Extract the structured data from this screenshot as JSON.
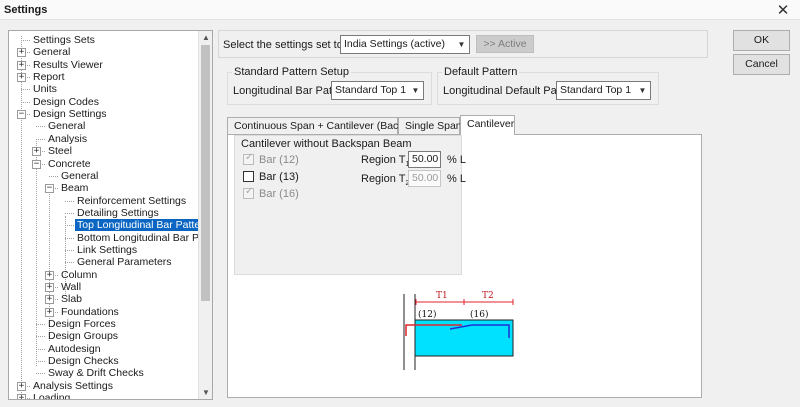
{
  "window": {
    "title": "Settings",
    "close_glyph": "✕"
  },
  "tree": {
    "collapse_glyph": "−",
    "expand_glyph": "+",
    "items": [
      {
        "label": "Settings Sets"
      },
      {
        "label": "General"
      },
      {
        "label": "Results Viewer"
      },
      {
        "label": "Report"
      },
      {
        "label": "Units"
      },
      {
        "label": "Design Codes"
      },
      {
        "label": "Design Settings"
      },
      {
        "label": "General"
      },
      {
        "label": "Analysis"
      },
      {
        "label": "Steel"
      },
      {
        "label": "Concrete"
      },
      {
        "label": "General"
      },
      {
        "label": "Beam"
      },
      {
        "label": "Reinforcement Settings"
      },
      {
        "label": "Detailing Settings"
      },
      {
        "label": "Top Longitudinal Bar Pattern"
      },
      {
        "label": "Bottom Longitudinal Bar Pattern"
      },
      {
        "label": "Link Settings"
      },
      {
        "label": "General Parameters"
      },
      {
        "label": "Column"
      },
      {
        "label": "Wall"
      },
      {
        "label": "Slab"
      },
      {
        "label": "Foundations"
      },
      {
        "label": "Design Forces"
      },
      {
        "label": "Design Groups"
      },
      {
        "label": "Autodesign"
      },
      {
        "label": "Design Checks"
      },
      {
        "label": "Sway & Drift Checks"
      },
      {
        "label": "Analysis Settings"
      },
      {
        "label": "Loading"
      }
    ],
    "scroll_up": "▲",
    "scroll_down": "▼"
  },
  "selector": {
    "label": "Select the settings set to edit:",
    "value": "India Settings (active)",
    "active_button": ">> Active"
  },
  "buttons": {
    "ok": "OK",
    "cancel": "Cancel"
  },
  "standard_pattern": {
    "title": "Standard Pattern Setup",
    "label": "Longitudinal Bar Pattern",
    "value": "Standard Top 1"
  },
  "default_pattern": {
    "title": "Default Pattern",
    "label": "Longitudinal Default Pattern",
    "value": "Standard Top 1"
  },
  "tabs": {
    "continuous": "Continuous Span + Cantilever (Backspan)",
    "single": "Single Span",
    "cantilever": "Cantilever"
  },
  "cantilever": {
    "group_title": "Cantilever without Backspan Beam",
    "bar12": "Bar (12)",
    "bar13": "Bar (13)",
    "bar16": "Bar (16)",
    "region_label": "Region T",
    "sub1": "1",
    "sub2": "2",
    "t1_value": "50.00",
    "t2_value": "50.00",
    "unit": "% L",
    "check_glyph": "✓"
  },
  "diagram": {
    "t1": "T1",
    "t2": "T2",
    "bar12": "(12)",
    "bar16": "(16)"
  },
  "dropdown_glyph": "▼"
}
